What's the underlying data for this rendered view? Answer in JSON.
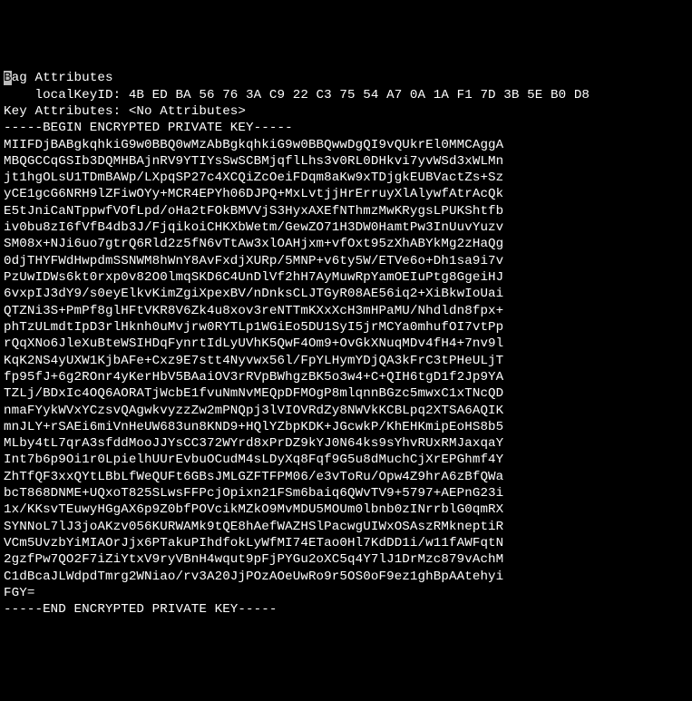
{
  "lines": [
    {
      "parts": [
        {
          "text": "B",
          "highlight": true
        },
        {
          "text": "ag Attributes"
        }
      ]
    },
    {
      "parts": [
        {
          "text": "    localKeyID: 4B ED BA 56 76 3A C9 22 C3 75 54 A7 0A 1A F1 7D 3B 5E B0 D8"
        }
      ]
    },
    {
      "parts": [
        {
          "text": "Key Attributes: <No Attributes>"
        }
      ]
    },
    {
      "parts": [
        {
          "text": "-----BEGIN ENCRYPTED PRIVATE KEY-----"
        }
      ]
    },
    {
      "parts": [
        {
          "text": "MIIFDjBABgkqhkiG9w0BBQ0wMzAbBgkqhkiG9w0BBQwwDgQI9vQUkrEl0MMCAggA"
        }
      ]
    },
    {
      "parts": [
        {
          "text": "MBQGCCqGSIb3DQMHBAjnRV9YTIYsSwSCBMjqflLhs3v0RL0DHkvi7yvWSd3xWLMn"
        }
      ]
    },
    {
      "parts": [
        {
          "text": "jt1hgOLsU1TDmBAWp/LXpqSP27c4XCQiZcOeiFDqm8aKw9xTDjgkEUBVactZs+Sz"
        }
      ]
    },
    {
      "parts": [
        {
          "text": "yCE1gcG6NRH9lZFiwOYy+MCR4EPYh06DJPQ+MxLvtjjHrErruyXlAlywfAtrAcQk"
        }
      ]
    },
    {
      "parts": [
        {
          "text": "E5tJniCaNTppwfVOfLpd/oHa2tFOkBMVVjS3HyxAXEfNThmzMwKRygsLPUKShtfb"
        }
      ]
    },
    {
      "parts": [
        {
          "text": "iv0bu8zI6fVfB4db3J/FjqikoiCHKXbWetm/GewZO71H3DW0HamtPw3InUuvYuzv"
        }
      ]
    },
    {
      "parts": [
        {
          "text": "SM08x+NJi6uo7gtrQ6Rld2z5fN6vTtAw3xlOAHjxm+vfOxt95zXhABYkMg2zHaQg"
        }
      ]
    },
    {
      "parts": [
        {
          "text": "0djTHYFWdHwpdmSSNWM8hWnY8AvFxdjXURp/5MNP+v6ty5W/ETVe6o+Dh1sa9i7v"
        }
      ]
    },
    {
      "parts": [
        {
          "text": "PzUwIDWs6kt0rxp0v82O0lmqSKD6C4UnDlVf2hH7AyMuwRpYamOEIuPtg8GgeiHJ"
        }
      ]
    },
    {
      "parts": [
        {
          "text": "6vxpIJ3dY9/s0eyElkvKimZgiXpexBV/nDnksCLJTGyR08AE56iq2+XiBkwIoUai"
        }
      ]
    },
    {
      "parts": [
        {
          "text": "QTZNi3S+PmPf8glHFtVKR8V6Zk4u8xov3reNTTmKXxXcH3mHPaMU/Nhdldn8fpx+"
        }
      ]
    },
    {
      "parts": [
        {
          "text": "phTzULmdtIpD3rlHknh0uMvjrw0RYTLp1WGiEo5DU1SyI5jrMCYa0mhufOI7vtPp"
        }
      ]
    },
    {
      "parts": [
        {
          "text": "rQqXNo6JleXuBteWSIHDqFynrtIdLyUVhK5QwF4Om9+OvGkXNuqMDv4fH4+7nv9l"
        }
      ]
    },
    {
      "parts": [
        {
          "text": "KqK2NS4yUXW1KjbAFe+Cxz9E7stt4Nyvwx56l/FpYLHymYDjQA3kFrC3tPHeULjT"
        }
      ]
    },
    {
      "parts": [
        {
          "text": "fp95fJ+6g2ROnr4yKerHbV5BAaiOV3rRVpBWhgzBK5o3w4+C+QIH6tgD1f2Jp9YA"
        }
      ]
    },
    {
      "parts": [
        {
          "text": "TZLj/BDxIc4OQ6AORATjWcbE1fvuNmNvMEQpDFMOgP8mlqnnBGzc5mwxC1xTNcQD"
        }
      ]
    },
    {
      "parts": [
        {
          "text": "nmaFYykWVxYCzsvQAgwkvyzzZw2mPNQpj3lVIOVRdZy8NWVkKCBLpq2XTSA6AQIK"
        }
      ]
    },
    {
      "parts": [
        {
          "text": "mnJLY+rSAEi6miVnHeUW683un8KND9+HQlYZbpKDK+JGcwkP/KhEHKmipEoHS8b5"
        }
      ]
    },
    {
      "parts": [
        {
          "text": "MLby4tL7qrA3sfddMooJJYsCC372WYrd8xPrDZ9kYJ0N64ks9sYhvRUxRMJaxqaY"
        }
      ]
    },
    {
      "parts": [
        {
          "text": "Int7b6p9Oi1r0LpielhUUrEvbuOCudM4sLDyXq8Fqf9G5u8dMuchCjXrEPGhmf4Y"
        }
      ]
    },
    {
      "parts": [
        {
          "text": "ZhTfQF3xxQYtLBbLfWeQUFt6GBsJMLGZFTFPM06/e3vToRu/Opw4Z9hrA6zBfQWa"
        }
      ]
    },
    {
      "parts": [
        {
          "text": "bcT868DNME+UQxoT825SLwsFFPcjOpixn21FSm6baiq6QWvTV9+5797+AEPnG23i"
        }
      ]
    },
    {
      "parts": [
        {
          "text": "1x/KKsvTEuwyHGgAX6p9Z0bfPOVcikMZkO9MvMDU5MOUm0lbnb0zINrrblG0qmRX"
        }
      ]
    },
    {
      "parts": [
        {
          "text": "SYNNoL7lJ3joAKzv056KURWAMk9tQE8hAefWAZHSlPacwgUIWxOSAszRMkneptiR"
        }
      ]
    },
    {
      "parts": [
        {
          "text": "VCm5UvzbYiMIAOrJjx6PTakuPIhdfokLyWfMI74ETao0Hl7KdDD1i/w11fAWFqtN"
        }
      ]
    },
    {
      "parts": [
        {
          "text": "2gzfPw7QO2F7iZiYtxV9ryVBnH4wqut9pFjPYGu2oXC5q4Y7lJ1DrMzc879vAchM"
        }
      ]
    },
    {
      "parts": [
        {
          "text": "C1dBcaJLWdpdTmrg2WNiao/rv3A20JjPOzAOeUwRo9r5OS0oF9ez1ghBpAAtehyi"
        }
      ]
    },
    {
      "parts": [
        {
          "text": "FGY="
        }
      ]
    },
    {
      "parts": [
        {
          "text": "-----END ENCRYPTED PRIVATE KEY-----"
        }
      ]
    }
  ]
}
